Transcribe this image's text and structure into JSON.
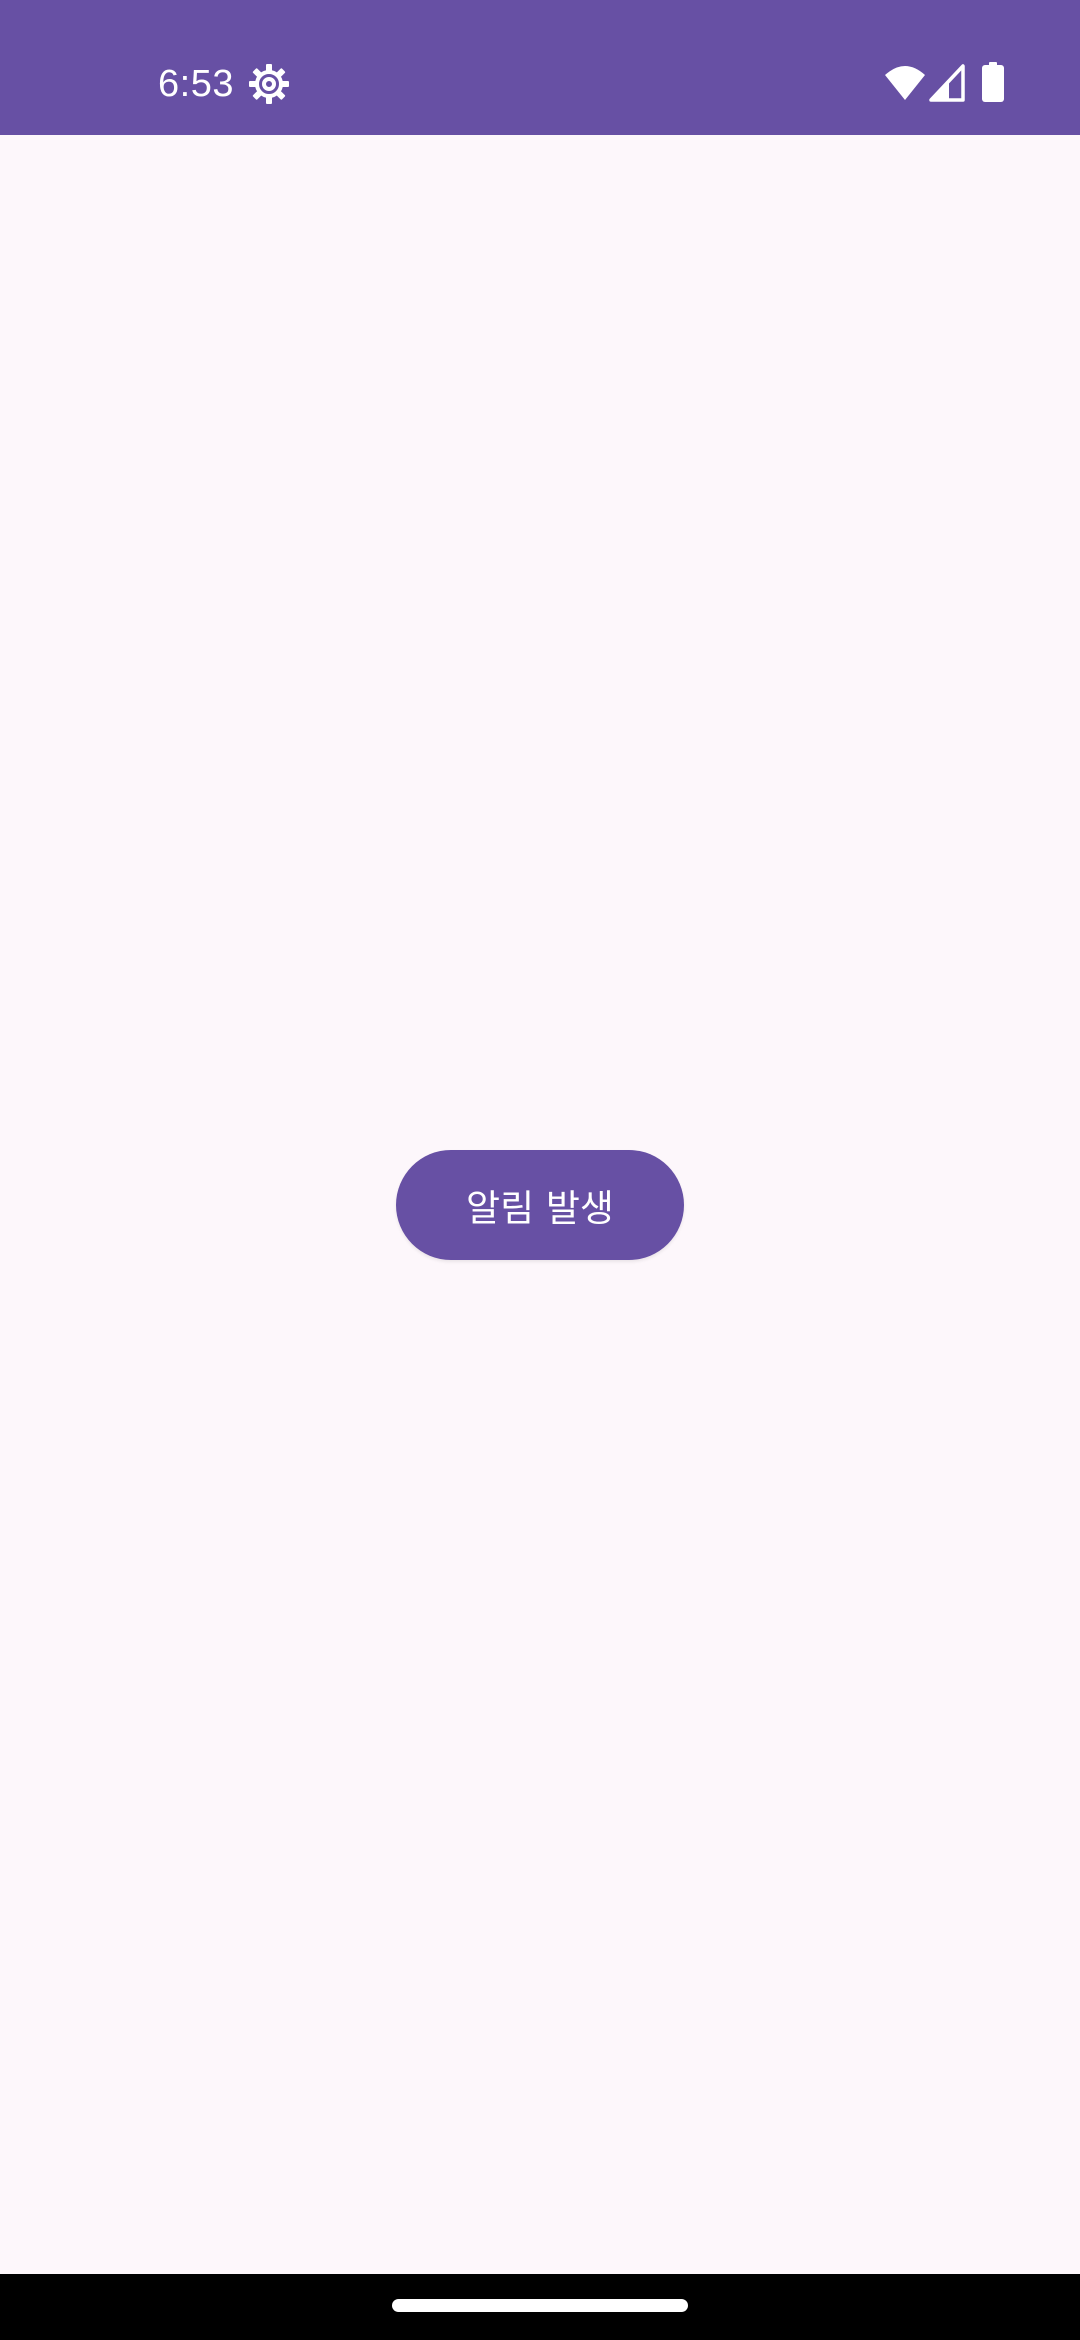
{
  "status_bar": {
    "time": "6:53",
    "background": "#6750a4",
    "icons": [
      "settings-icon",
      "wifi-icon",
      "cell-signal-icon",
      "battery-icon"
    ]
  },
  "main": {
    "background": "#fdf7fb",
    "notify_button_label": "알림 발생",
    "button_color": "#6750a4"
  },
  "navigation_bar": {
    "handle": "home-gesture-handle"
  }
}
